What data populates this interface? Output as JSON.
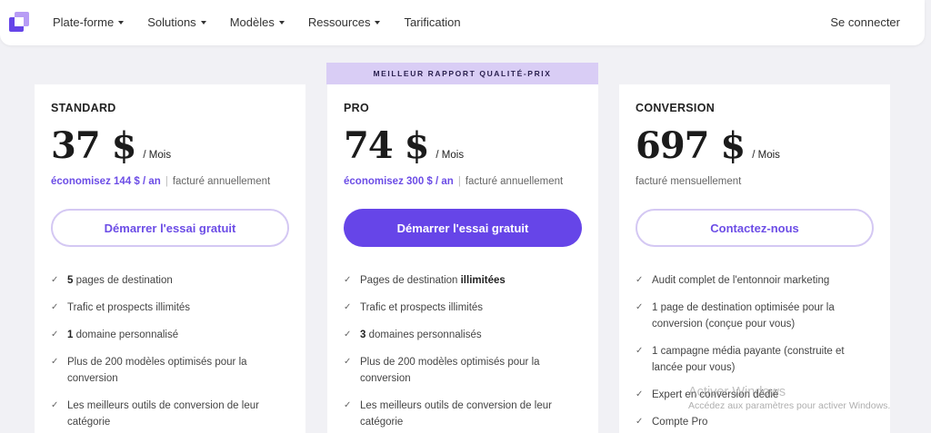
{
  "nav": {
    "menu": [
      {
        "label": "Plate-forme",
        "caret": true
      },
      {
        "label": "Solutions",
        "caret": true
      },
      {
        "label": "Modèles",
        "caret": true
      },
      {
        "label": "Ressources",
        "caret": true
      },
      {
        "label": "Tarification",
        "caret": false
      }
    ],
    "login": "Se connecter"
  },
  "ribbon": "MEILLEUR RAPPORT QUALITÉ-PRIX",
  "plans": [
    {
      "name": "STANDARD",
      "price": "37 $",
      "per": "/ Mois",
      "save": "économisez 144 $ / an",
      "billing": "facturé annuellement",
      "cta": "Démarrer l'essai gratuit",
      "features": [
        {
          "bold": "5",
          "text": " pages de destination"
        },
        {
          "bold": "",
          "text": "Trafic et prospects illimités"
        },
        {
          "bold": "1",
          "text": " domaine personnalisé"
        },
        {
          "bold": "",
          "text": "Plus de 200 modèles optimisés pour la conversion"
        },
        {
          "bold": "",
          "text": "Les meilleurs outils de conversion de leur catégorie"
        }
      ]
    },
    {
      "name": "PRO",
      "price": "74 $",
      "per": "/ Mois",
      "save": "économisez 300 $ / an",
      "billing": "facturé annuellement",
      "cta": "Démarrer l'essai gratuit",
      "features": [
        {
          "pre": "Pages de destination ",
          "bold": "illimitées",
          "text": ""
        },
        {
          "bold": "",
          "text": "Trafic et prospects illimités"
        },
        {
          "bold": "3",
          "text": " domaines personnalisés"
        },
        {
          "bold": "",
          "text": "Plus de 200 modèles optimisés pour la conversion"
        },
        {
          "bold": "",
          "text": "Les meilleurs outils de conversion de leur catégorie"
        }
      ]
    },
    {
      "name": "CONVERSION",
      "price": "697 $",
      "per": "/ Mois",
      "save": "",
      "billing": "facturé mensuellement",
      "cta": "Contactez-nous",
      "features": [
        {
          "bold": "",
          "text": "Audit complet de l'entonnoir marketing"
        },
        {
          "bold": "",
          "text": "1 page de destination optimisée pour la conversion (conçue pour vous)"
        },
        {
          "bold": "",
          "text": "1 campagne média payante (construite et lancée pour vous)"
        },
        {
          "bold": "",
          "text": "Expert en conversion dédié"
        },
        {
          "bold": "",
          "text": "Compte Pro"
        }
      ]
    }
  ],
  "watermark": {
    "title": "Activer Windows",
    "subtitle": "Accédez aux paramètres pour activer Windows."
  },
  "colors": {
    "accent": "#6645e8",
    "ribbon": "#d9cdf5",
    "save_text": "#6c4de6"
  },
  "icons": {
    "logo": "brand-logo-icon",
    "check": "check-icon",
    "caret": "chevron-down-icon"
  }
}
